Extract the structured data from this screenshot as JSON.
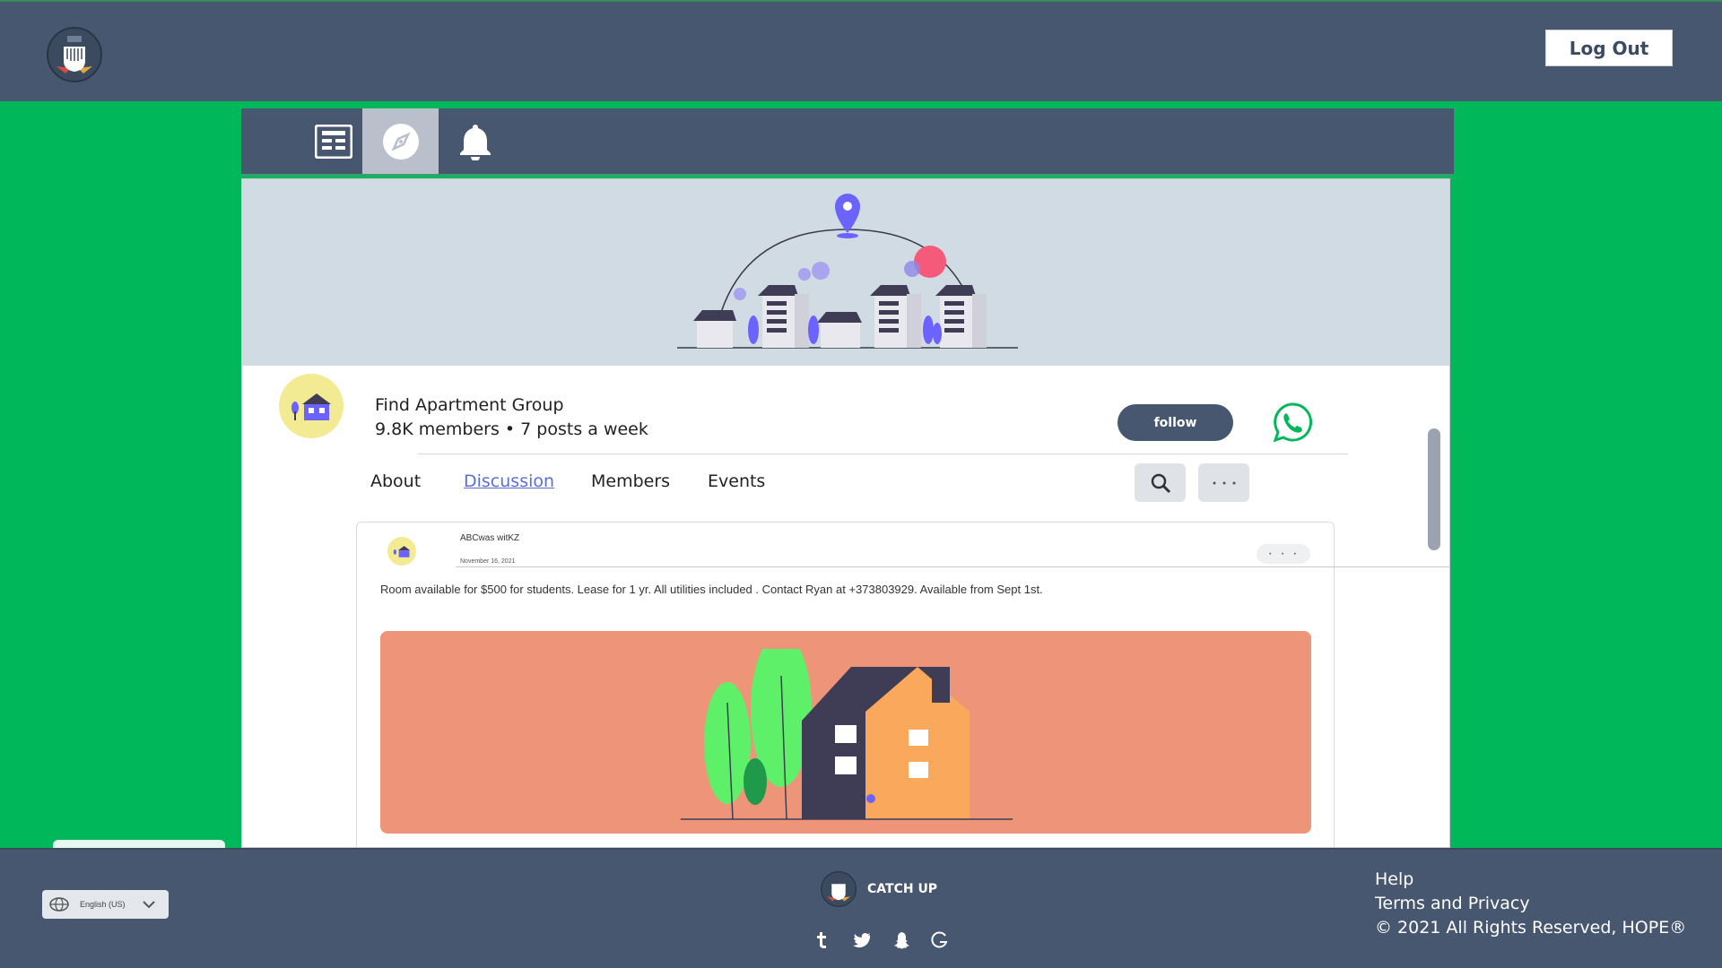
{
  "header": {
    "logout_label": "Log Out",
    "logo_icon": "hope-logo-icon"
  },
  "tabs": [
    {
      "icon": "newspaper-icon",
      "active": false
    },
    {
      "icon": "compass-icon",
      "active": true
    },
    {
      "icon": "bell-icon",
      "active": false
    }
  ],
  "group": {
    "name": "Find Apartment Group",
    "meta": "9.8K members • 7 posts a week",
    "follow_label": "follow"
  },
  "nav": {
    "about": "About",
    "discussion": "Discussion",
    "members": "Members",
    "events": "Events",
    "active": "Discussion"
  },
  "post": {
    "author": "ABCwas witKZ",
    "date": "November 16, 2021",
    "text": "Room available for $500 for students. Lease for 1 yr. All utilities included . Contact Ryan at  +373803929. Available from Sept 1st.",
    "more": "· · ·"
  },
  "footer": {
    "language": "English (US)",
    "brand": "CATCH UP",
    "help": "Help",
    "terms": "Terms and Privacy",
    "copyright": "© 2021 All Rights Reserved, HOPE®"
  },
  "colors": {
    "background": "#00b859",
    "bar": "#475770",
    "accent": "#5a6fd6",
    "banner": "#d1dbe4",
    "post_image_bg": "#ee9478"
  }
}
